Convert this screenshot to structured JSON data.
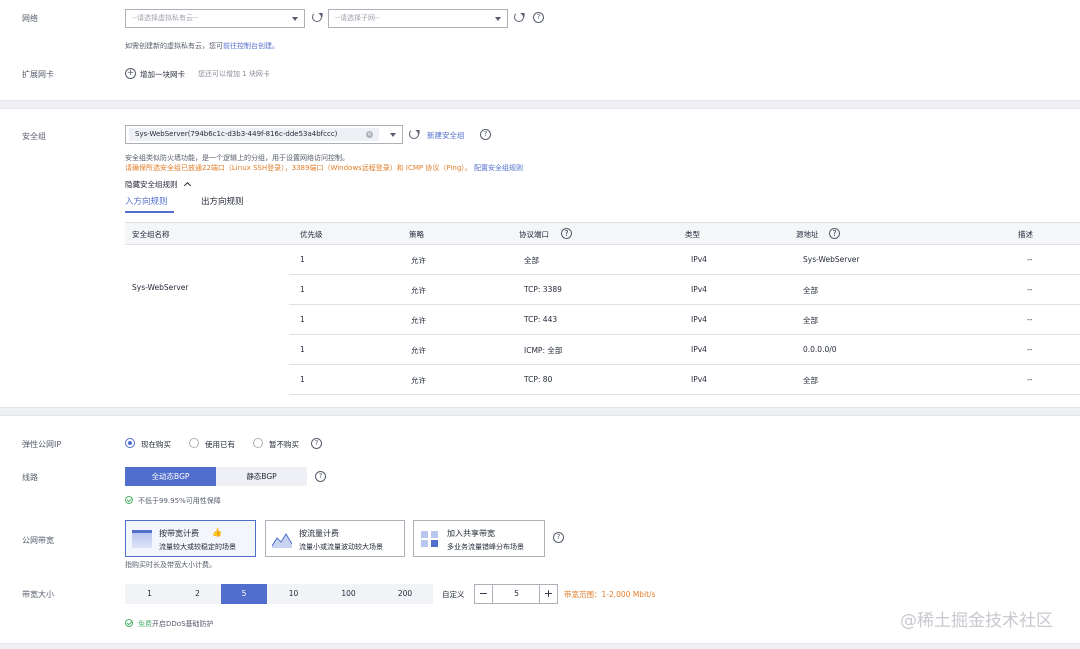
{
  "network": {
    "label": "网络",
    "vpc_placeholder": "--请选择虚拟私有云--",
    "subnet_placeholder": "--请选择子网--",
    "hint_prefix": "如需创建新的虚拟私有云，您可",
    "hint_link": "前往控制台创建。"
  },
  "nic": {
    "label": "扩展网卡",
    "add_label": "增加一块网卡",
    "add_hint": "您还可以增加 1 块网卡"
  },
  "security_group": {
    "label": "安全组",
    "selected": "Sys-WebServer(794b6c1c-d3b3-449f-816c-dde53a4bfccc)",
    "create_link": "新建安全组",
    "desc": "安全组类似防火墙功能，是一个逻辑上的分组，用于设置网络访问控制。",
    "warn": "请确保所选安全组已放通22端口（Linux SSH登录），3389端口（Windows远程登录）和 ICMP 协议（Ping）。",
    "config_link": "配置安全组规则",
    "hide_rules": "隐藏安全组规则",
    "tabs": [
      "入方向规则",
      "出方向规则"
    ],
    "table": {
      "headers": [
        "安全组名称",
        "优先级",
        "策略",
        "协议端口",
        "类型",
        "源地址",
        "描述"
      ],
      "group_name": "Sys-WebServer",
      "rows": [
        {
          "priority": "1",
          "policy": "允许",
          "port": "全部",
          "type": "IPv4",
          "source": "Sys-WebServer",
          "desc": "--"
        },
        {
          "priority": "1",
          "policy": "允许",
          "port": "TCP: 3389",
          "type": "IPv4",
          "source": "全部",
          "desc": "--"
        },
        {
          "priority": "1",
          "policy": "允许",
          "port": "TCP: 443",
          "type": "IPv4",
          "source": "全部",
          "desc": "--"
        },
        {
          "priority": "1",
          "policy": "允许",
          "port": "ICMP: 全部",
          "type": "IPv4",
          "source": "0.0.0.0/0",
          "desc": "--"
        },
        {
          "priority": "1",
          "policy": "允许",
          "port": "TCP: 80",
          "type": "IPv4",
          "source": "全部",
          "desc": "--"
        }
      ]
    }
  },
  "eip": {
    "label": "弹性公网IP",
    "options": [
      "现在购买",
      "使用已有",
      "暂不购买"
    ],
    "selected": "现在购买"
  },
  "line": {
    "label": "线路",
    "options": [
      "全动态BGP",
      "静态BGP"
    ],
    "selected": "全动态BGP",
    "note": "不低于99.95%可用性保障"
  },
  "bandwidth": {
    "label": "公网带宽",
    "cards": [
      {
        "title": "按带宽计费",
        "sub": "流量较大或较稳定的场景"
      },
      {
        "title": "按流量计费",
        "sub": "流量小或流量波动较大场景"
      },
      {
        "title": "加入共享带宽",
        "sub": "多业务流量错峰分布场景"
      }
    ],
    "note": "指购买时长及带宽大小计费。"
  },
  "bw_size": {
    "label": "带宽大小",
    "options": [
      "1",
      "2",
      "5",
      "10",
      "100",
      "200"
    ],
    "selected": "5",
    "custom_label": "自定义",
    "value": "5",
    "range": "带宽范围：1-2,000 Mbit/s",
    "ddos_free": "免费",
    "ddos_rest": "开启DDoS基础防护"
  },
  "watermark": "@稀土掘金技术社区",
  "colors": {
    "accent": "#526ecc",
    "warning": "#e37d29",
    "success": "#50b36f",
    "section_bg": "#eff0f3"
  }
}
